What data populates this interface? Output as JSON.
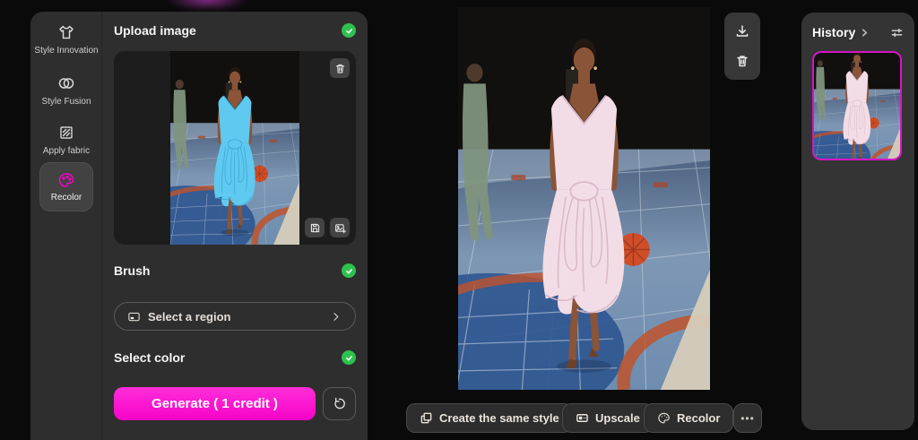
{
  "sidebar": {
    "items": [
      {
        "label": "Style Innovation",
        "icon": "shirt-icon"
      },
      {
        "label": "Style Fusion",
        "icon": "blend-circles-icon"
      },
      {
        "label": "Apply fabric",
        "icon": "fabric-swatch-icon"
      },
      {
        "label": "Recolor",
        "icon": "palette-icon",
        "selected": true
      }
    ]
  },
  "upload": {
    "title": "Upload image",
    "status": "complete"
  },
  "brush": {
    "title": "Brush",
    "region_button": "Select a region",
    "status": "complete"
  },
  "color_section": {
    "title": "Select color",
    "status": "complete"
  },
  "generate": {
    "label": "Generate ( 1 credit )"
  },
  "viewer": {
    "actions": {
      "same_style": "Create the same style",
      "upscale": "Upscale",
      "recolor": "Recolor",
      "more": "•••"
    }
  },
  "history": {
    "title": "History"
  },
  "icons": {
    "preview": [
      "trash-icon",
      "save-icon",
      "add-image-icon"
    ],
    "rail": [
      "download-icon",
      "trash-icon"
    ],
    "pill": [
      "region-select-icon",
      "chevron-right-icon"
    ],
    "other": [
      "reset-icon",
      "filter-icon",
      "copy-icon",
      "upscale-icon",
      "palette-icon"
    ]
  },
  "scene": {
    "source_dress": "#5fc9ef",
    "source_dress_shade": "#38a8d6",
    "result_dress": "#f2dde6",
    "result_dress_shade": "#d9b7c8",
    "skin": "#8a5438",
    "hair": "#241812",
    "floor_blue": "#2f5590",
    "pom_orange": "#cf4d28",
    "green_model": "#7f947e"
  },
  "colors": {
    "accent": "#f702c8",
    "accent_light": "#ff2fd9",
    "check_green": "#2fc14f",
    "history_border": "#d416c6",
    "glow_purple": "#8d2f90"
  }
}
